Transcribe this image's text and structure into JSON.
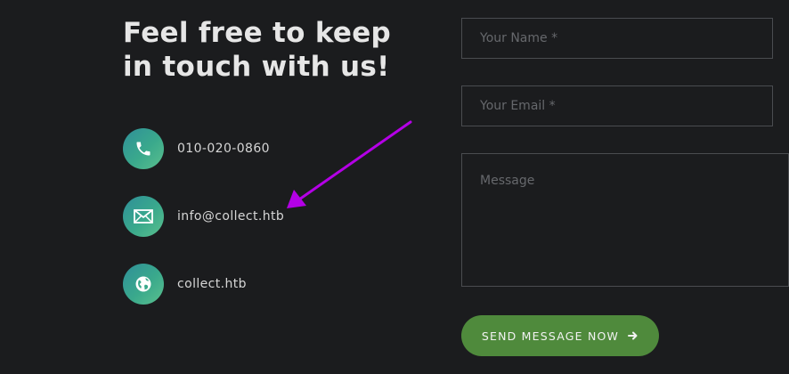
{
  "heading": "Feel free to keep in touch with us!",
  "contacts": {
    "phone": {
      "text": "010-020-0860",
      "icon": "phone-icon"
    },
    "email": {
      "text": "info@collect.htb",
      "icon": "envelope-icon"
    },
    "website": {
      "text": "collect.htb",
      "icon": "globe-icon"
    }
  },
  "form": {
    "name_placeholder": "Your Name *",
    "email_placeholder": "Your Email *",
    "message_placeholder": "Message",
    "submit_label": "SEND MESSAGE NOW",
    "submit_icon": "arrow-right-icon"
  },
  "colors": {
    "background": "#1b1c1e",
    "icon_gradient_start": "#2f8f99",
    "icon_gradient_end": "#5bc08e",
    "button": "#4f8a3c",
    "annotation_arrow": "#b400e6"
  }
}
